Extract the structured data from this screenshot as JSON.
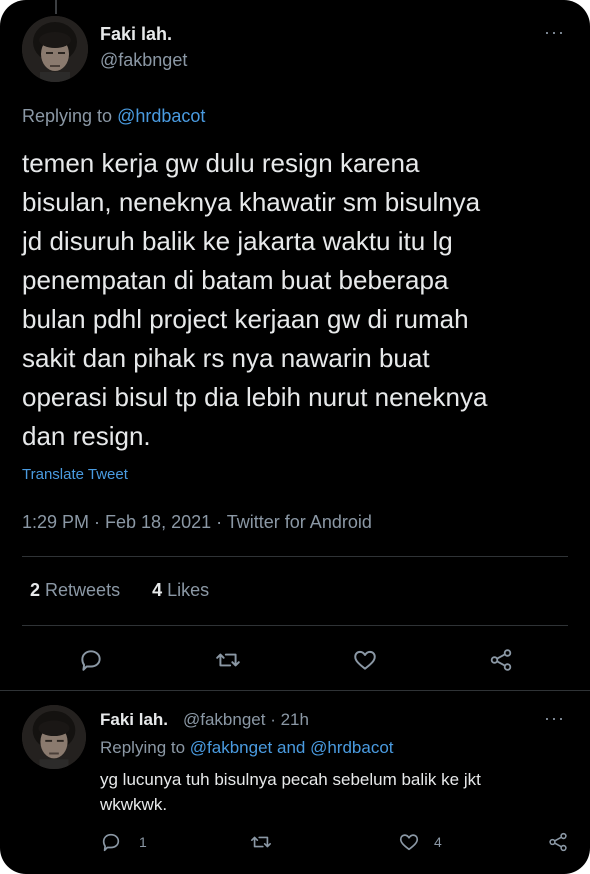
{
  "main_tweet": {
    "name": "Faki lah.",
    "handle": "@fakbnget",
    "replying_prefix": "Replying to",
    "replying_to": "@hrdbacot",
    "lines": [
      "temen kerja gw dulu resign karena",
      "bisulan, neneknya khawatir sm bisulnya",
      "jd disuruh balik ke jakarta waktu itu lg",
      "penempatan di batam buat beberapa",
      "bulan pdhl project kerjaan gw di rumah",
      "sakit dan pihak rs nya nawarin buat",
      "operasi bisul tp dia lebih nurut neneknya",
      "dan resign."
    ],
    "translate": "Translate Tweet",
    "timestamp": "1:29 PM · Feb 18, 2021 · Twitter for Android",
    "retweets_count": "2",
    "retweets_label": "Retweets",
    "likes_count": "4",
    "likes_label": "Likes"
  },
  "reply_tweet": {
    "name": "Faki lah.",
    "handle": "@fakbnget",
    "time": "· 21h",
    "replying_prefix": "Replying to",
    "replying_to": "@fakbnget and @hrdbacot",
    "lines": [
      "yg lucunya tuh bisulnya pecah sebelum balik ke jkt",
      "wkwkwk."
    ],
    "reply_count": "1",
    "like_count": "4"
  },
  "icons": {
    "more": "more-dots-icon",
    "reply": "reply-icon",
    "retweet": "retweet-icon",
    "like": "heart-icon",
    "share": "share-icon"
  },
  "colors": {
    "background": "#000000",
    "text": "#e7e9ea",
    "secondary": "#8b98a5",
    "link": "#4a9be0",
    "divider": "#2f3336"
  },
  "more_label": "···"
}
